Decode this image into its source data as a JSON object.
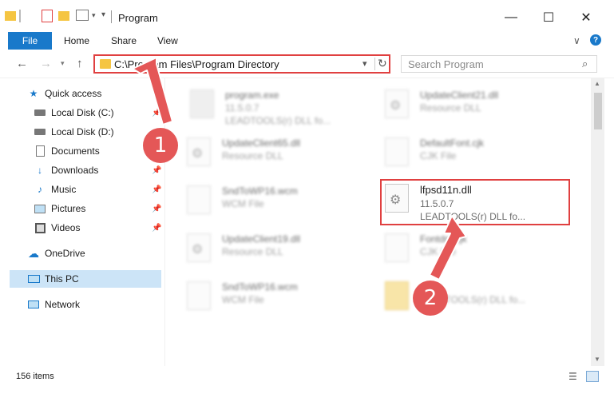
{
  "window": {
    "title": "Program",
    "minimize": "—",
    "maximize": "☐",
    "close": "✕"
  },
  "ribbon": {
    "file": "File",
    "home": "Home",
    "share": "Share",
    "view": "View",
    "expand": "∨",
    "help": "?"
  },
  "navigation": {
    "back": "←",
    "forward": "→",
    "up": "↑",
    "address": "C:\\Program Files\\Program Directory",
    "search_placeholder": "Search Program"
  },
  "sidebar": {
    "items": [
      {
        "label": "Quick access",
        "icon": "star-icon"
      },
      {
        "label": "Local Disk (C:)",
        "icon": "drive-icon"
      },
      {
        "label": "Local Disk (D:)",
        "icon": "drive-icon"
      },
      {
        "label": "Documents",
        "icon": "documents-icon"
      },
      {
        "label": "Downloads",
        "icon": "downloads-icon"
      },
      {
        "label": "Music",
        "icon": "music-icon"
      },
      {
        "label": "Pictures",
        "icon": "pictures-icon"
      },
      {
        "label": "Videos",
        "icon": "videos-icon"
      },
      {
        "label": "OneDrive",
        "icon": "cloud-icon"
      },
      {
        "label": "This PC",
        "icon": "computer-icon"
      },
      {
        "label": "Network",
        "icon": "network-icon"
      }
    ]
  },
  "files": [
    {
      "name": "program.exe",
      "line1": "11.5.0.7",
      "line2": "LEADTOOLS(r) DLL fo..."
    },
    {
      "name": "UpdateClient21.dll",
      "line1": "Resource DLL",
      "line2": ""
    },
    {
      "name": "UpdateClient65.dll",
      "line1": "Resource DLL",
      "line2": ""
    },
    {
      "name": "DefaultFont.cjk",
      "line1": "CJK File",
      "line2": ""
    },
    {
      "name": "SndToWP16.wcm",
      "line1": "WCM File",
      "line2": ""
    },
    {
      "name": "lfpsd11n.dll",
      "line1": "11.5.0.7",
      "line2": "LEADTOOLS(r) DLL fo..."
    },
    {
      "name": "UpdateClient19.dll",
      "line1": "Resource DLL",
      "line2": ""
    },
    {
      "name": "Fontdm.cjk",
      "line1": "CJK File",
      "line2": ""
    },
    {
      "name": "SndToWP16.wcm",
      "line1": "WCM File",
      "line2": ""
    },
    {
      "name": "",
      "line1": "LEADTOOLS(r) DLL fo...",
      "line2": ""
    }
  ],
  "status": {
    "item_count": "156 items"
  },
  "annotations": {
    "step1": "1",
    "step2": "2",
    "color": "#e45757"
  }
}
